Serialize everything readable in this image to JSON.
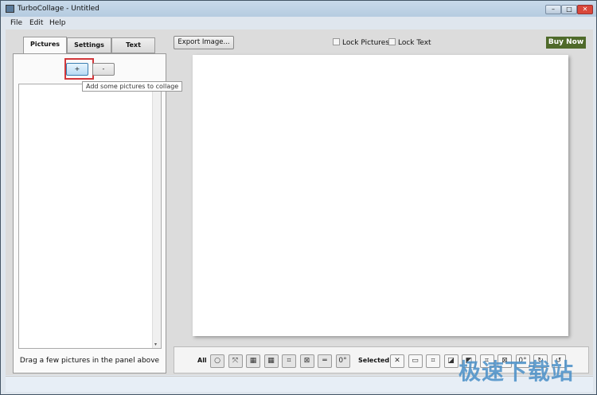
{
  "window": {
    "title": "TurboCollage - Untitled",
    "minimize": "–",
    "maximize": "□",
    "close": "✕",
    "close_color": "#d9483b"
  },
  "menu": [
    "File",
    "Edit",
    "Help"
  ],
  "tabs": [
    "Pictures",
    "Settings",
    "Text"
  ],
  "pictures_panel": {
    "add_label": "+",
    "remove_label": "-",
    "tooltip": "Add some pictures to collage",
    "hint": "Drag a few pictures in the panel above"
  },
  "top_bar": {
    "export_label": "Export Image...",
    "lock_pictures": "Lock Pictures",
    "lock_text": "Lock Text",
    "buy_now": "Buy Now",
    "buy_color": "#4f6a2a"
  },
  "toolbar": {
    "all_label": "All",
    "all_icons": [
      "○",
      "⤧",
      "▦",
      "▦",
      "⌗",
      "⊠",
      "═",
      "0°"
    ],
    "selected_label": "Selected",
    "selected_icons": [
      "✕",
      "▭",
      "⌗",
      "◪",
      "◩",
      "⌗",
      "⊠",
      "0°",
      "↻",
      "↺"
    ]
  },
  "watermark": "极速下载站"
}
